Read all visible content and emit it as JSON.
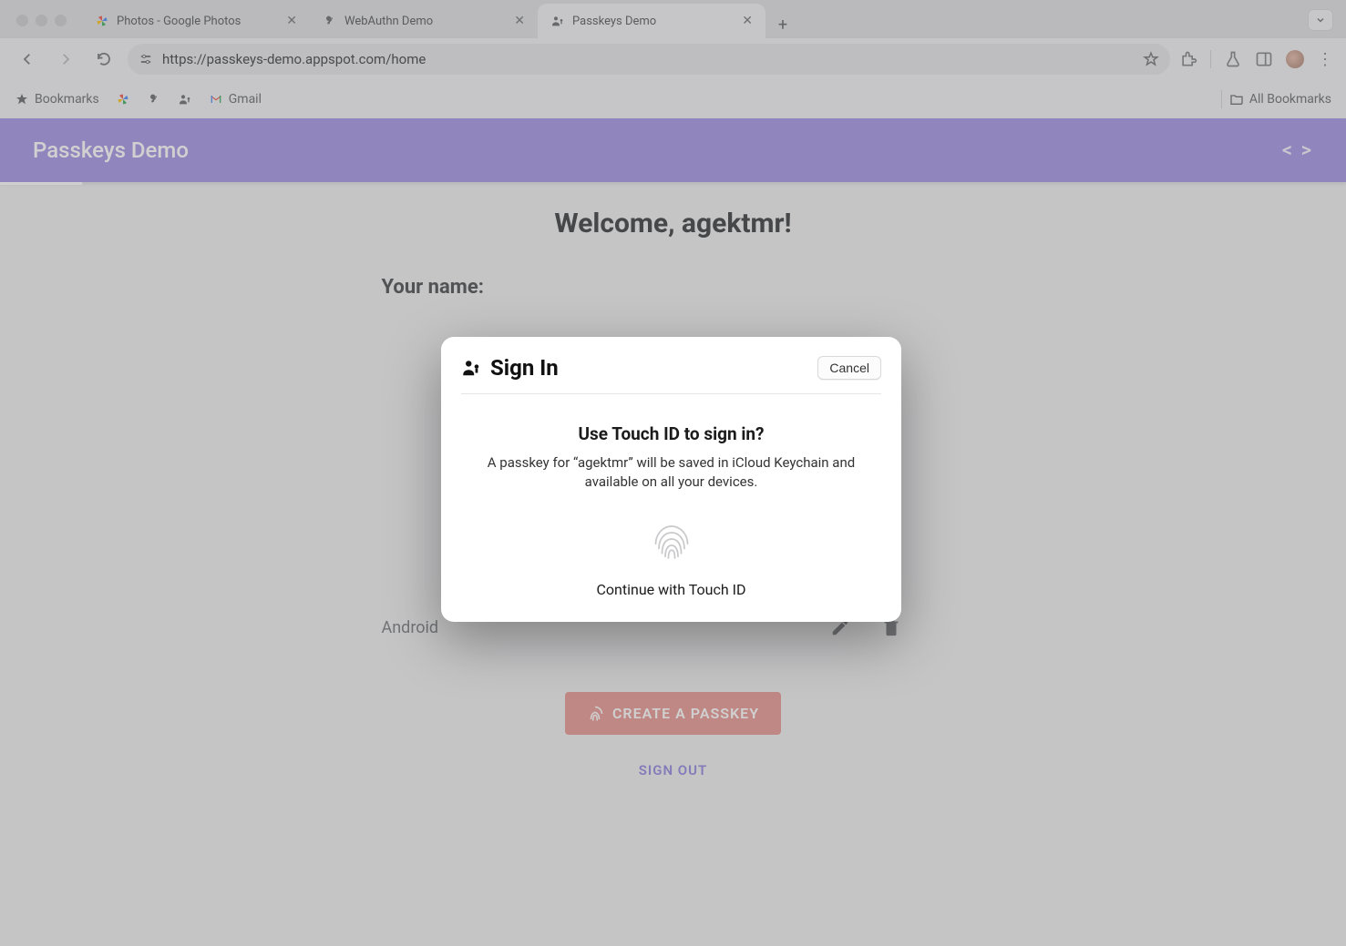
{
  "browser": {
    "tabs": [
      {
        "title": "Photos - Google Photos",
        "icon": "google-photos"
      },
      {
        "title": "WebAuthn Demo",
        "icon": "key"
      },
      {
        "title": "Passkeys Demo",
        "icon": "person-key",
        "active": true
      }
    ],
    "url": "https://passkeys-demo.appspot.com/home",
    "bookmarks_label": "Bookmarks",
    "gmail_label": "Gmail",
    "all_bookmarks_label": "All Bookmarks"
  },
  "app": {
    "title": "Passkeys Demo"
  },
  "page": {
    "welcome": "Welcome, agektmr!",
    "your_name_label": "Your name:",
    "credentials": [
      {
        "name": "Android"
      }
    ],
    "create_button": "CREATE A PASSKEY",
    "signout": "SIGN OUT"
  },
  "modal": {
    "title": "Sign In",
    "cancel": "Cancel",
    "heading": "Use Touch ID to sign in?",
    "body": "A passkey for “agektmr” will be saved in iCloud Keychain and available on all your devices.",
    "continue": "Continue with Touch ID"
  }
}
